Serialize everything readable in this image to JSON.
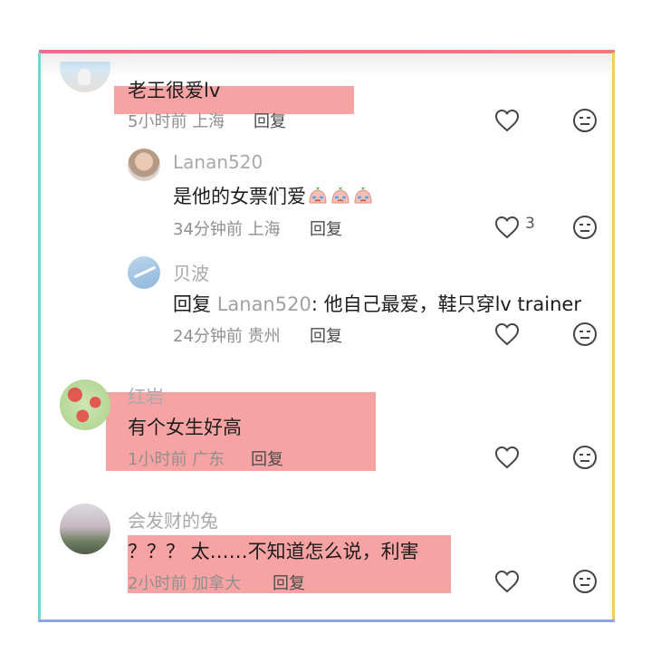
{
  "comments": [
    {
      "name": "",
      "text": "老王很爱lv",
      "time": "5小时前",
      "location": "上海",
      "reply_label": "回复"
    },
    {
      "name": "Lanan520",
      "text": "是他的女票们爱",
      "emoji": [
        "crying-face",
        "crying-face",
        "crying-face"
      ],
      "time": "34分钟前",
      "location": "上海",
      "reply_label": "回复",
      "likes": "3"
    },
    {
      "name": "贝波",
      "reply_prefix": "回复",
      "reply_to": "Lanan520",
      "text": ": 他自己最爱，鞋只穿lv trainer",
      "time": "24分钟前",
      "location": "贵州",
      "reply_label": "回复"
    },
    {
      "name": "红岩",
      "text": "有个女生好高",
      "time": "1小时前",
      "location": "广东",
      "reply_label": "回复"
    },
    {
      "name": "会发财的兔",
      "text": "？？？ 太……不知道怎么说，利害",
      "time": "2小时前",
      "location": "加拿大",
      "reply_label": "回复"
    }
  ],
  "colors": {
    "highlight": "#f79b9b",
    "border_top": "#ee6a8a",
    "border_left": "#7fd0d6",
    "border_right": "#f3cf5a",
    "border_bottom": "#8fa3e8"
  },
  "icons": {
    "like": "heart-outline-icon",
    "dislike": "neutral-face-icon"
  }
}
